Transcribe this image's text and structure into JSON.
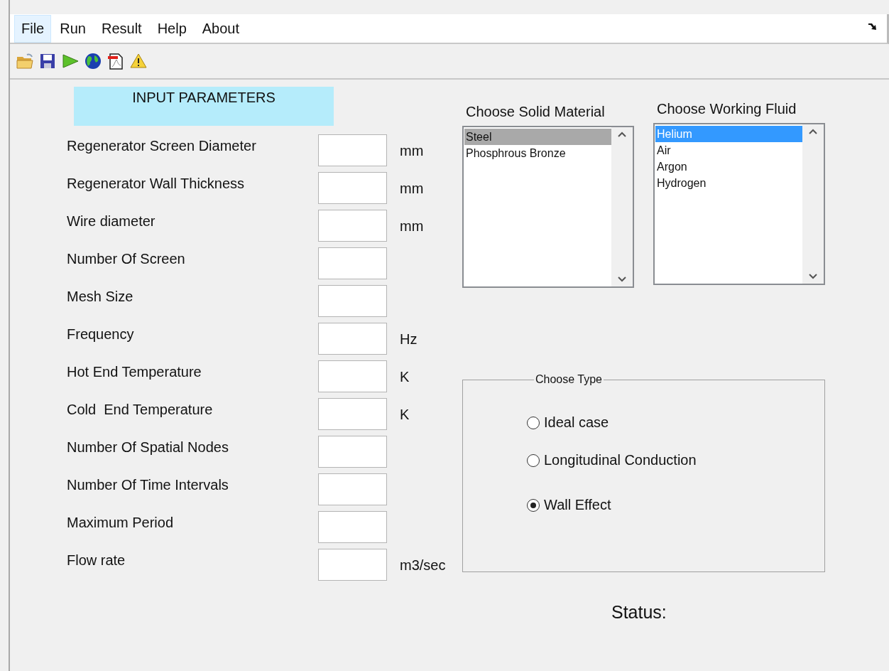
{
  "menu": [
    {
      "label": "File",
      "selected": true
    },
    {
      "label": "Run",
      "selected": false
    },
    {
      "label": "Result",
      "selected": false
    },
    {
      "label": "Help",
      "selected": false
    },
    {
      "label": "About",
      "selected": false
    }
  ],
  "panel_title": "INPUT PARAMETERS",
  "fields": [
    {
      "label": "Regenerator Screen Diameter",
      "unit": "mm"
    },
    {
      "label": "Regenerator Wall Thickness",
      "unit": "mm"
    },
    {
      "label": "Wire diameter",
      "unit": "mm"
    },
    {
      "label": "Number Of Screen"
    },
    {
      "label": "Mesh Size"
    },
    {
      "label": "Frequency",
      "unit": "Hz"
    },
    {
      "label": "Hot End Temperature",
      "unit": "K"
    },
    {
      "label": "Cold  End Temperature",
      "unit": "K"
    },
    {
      "label": "Number Of Spatial Nodes"
    },
    {
      "label": "Number Of Time Intervals"
    },
    {
      "label": "Maximum Period"
    },
    {
      "label": "Flow rate",
      "unit": "m3/sec"
    }
  ],
  "solid_material": {
    "label": "Choose Solid Material",
    "focused": false,
    "items": [
      {
        "label": "Steel",
        "selected": true
      },
      {
        "label": "Phosphrous Bronze",
        "selected": false
      }
    ]
  },
  "working_fluid": {
    "label": "Choose Working Fluid",
    "focused": true,
    "items": [
      {
        "label": "Helium",
        "selected": true
      },
      {
        "label": "Air",
        "selected": false
      },
      {
        "label": "Argon",
        "selected": false
      },
      {
        "label": "Hydrogen",
        "selected": false
      }
    ]
  },
  "choose_type": {
    "title": "Choose Type",
    "options": [
      {
        "label": "Ideal case",
        "selected": false
      },
      {
        "label": "Longitudinal Conduction",
        "selected": false
      },
      {
        "label": "Wall Effect",
        "selected": true
      }
    ]
  },
  "status": {
    "label": "Status:"
  }
}
